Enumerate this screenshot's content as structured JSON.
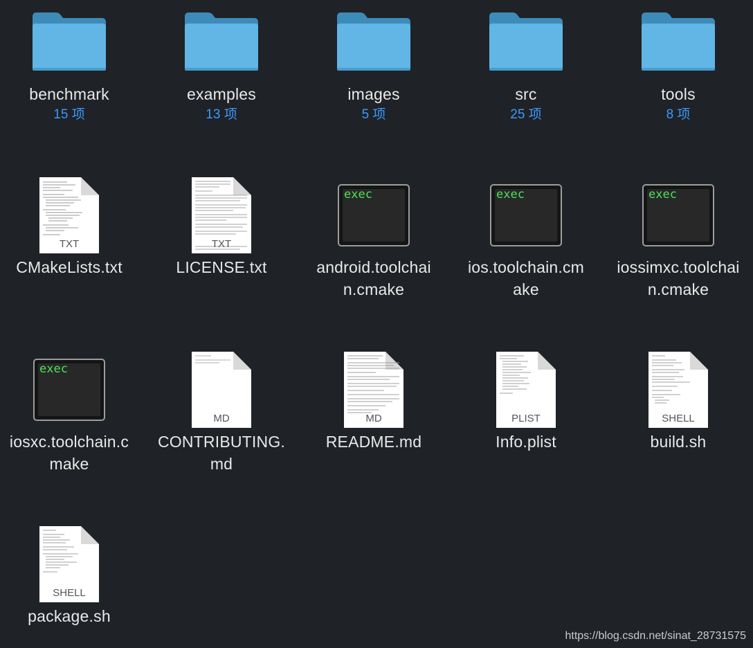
{
  "folders": [
    {
      "name": "benchmark",
      "count": "15 项",
      "color": "#5bb3e3"
    },
    {
      "name": "examples",
      "count": "13 项",
      "color": "#5bb3e3"
    },
    {
      "name": "images",
      "count": "5 项",
      "color": "#5bb3e3"
    },
    {
      "name": "src",
      "count": "25 项",
      "color": "#5bb3e3"
    },
    {
      "name": "tools",
      "count": "8 项",
      "color": "#5bb3e3"
    }
  ],
  "files_row2": [
    {
      "name": "CMakeLists.txt",
      "icon": "text-document-icon",
      "type_label": "TXT"
    },
    {
      "name": "LICENSE.txt",
      "icon": "text-document-icon",
      "type_label": "TXT"
    },
    {
      "name_line1": "android.toolchai",
      "name_line2": "n.cmake",
      "icon": "exec-icon",
      "type_label": "exec"
    },
    {
      "name_line1": "ios.toolchain.cm",
      "name_line2": "ake",
      "icon": "exec-icon",
      "type_label": "exec"
    },
    {
      "name_line1": "iossimxc.toolchai",
      "name_line2": "n.cmake",
      "icon": "exec-icon",
      "type_label": "exec"
    }
  ],
  "files_row3": [
    {
      "name_line1": "iosxc.toolchain.c",
      "name_line2": "make",
      "icon": "exec-icon",
      "type_label": "exec"
    },
    {
      "name_line1": "CONTRIBUTING.",
      "name_line2": "md",
      "icon": "markdown-document-icon",
      "type_label": "MD"
    },
    {
      "name": "README.md",
      "icon": "markdown-document-icon",
      "type_label": "MD"
    },
    {
      "name": "Info.plist",
      "icon": "plist-document-icon",
      "type_label": "PLIST"
    },
    {
      "name": "build.sh",
      "icon": "shell-document-icon",
      "type_label": "SHELL"
    }
  ],
  "files_row4": [
    {
      "name": "package.sh",
      "icon": "shell-document-icon",
      "type_label": "SHELL"
    }
  ],
  "watermark": "https://blog.csdn.net/sinat_28731575",
  "colors": {
    "background": "#1f2227",
    "count_text": "#3a9bff",
    "exec_text": "#4ee25b"
  }
}
